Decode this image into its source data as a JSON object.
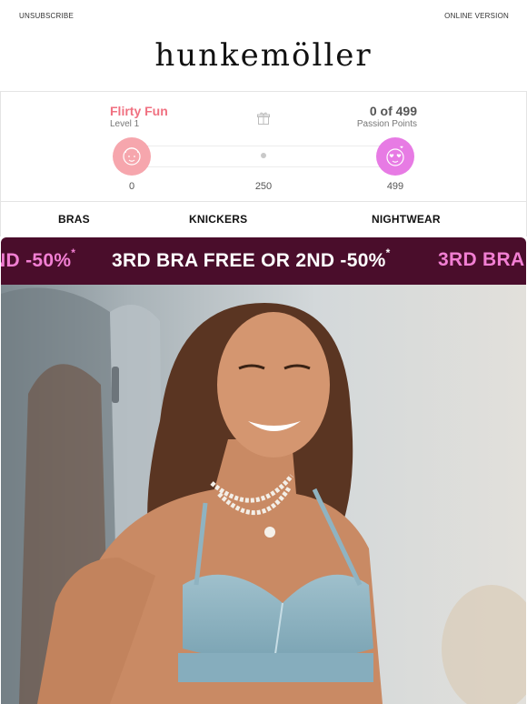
{
  "header": {
    "unsubscribe": "UNSUBSCRIBE",
    "online_version": "ONLINE VERSION",
    "brand": "hunkemöller"
  },
  "loyalty": {
    "tier_name": "Flirty Fun",
    "tier_level": "Level 1",
    "points": "0 of 499",
    "points_label": "Passion Points",
    "progress": 0,
    "scale": [
      "0",
      "250",
      "499"
    ],
    "colors": {
      "tier": "#f07181",
      "start_badge": "#f6a6ad",
      "end_badge": "#e77be4"
    }
  },
  "nav": {
    "items": [
      "BRAS",
      "KNICKERS",
      "NIGHTWEAR"
    ]
  },
  "promo": {
    "segments": [
      "ND -50%",
      "3RD BRA FREE OR 2ND -50%",
      "3RD BRA"
    ],
    "marker": "*",
    "colors": {
      "background": "#4a0d2b",
      "highlight": "#f27fd3",
      "text": "#ffffff"
    }
  },
  "hero": {
    "icon": "lingerie-model-photo"
  }
}
